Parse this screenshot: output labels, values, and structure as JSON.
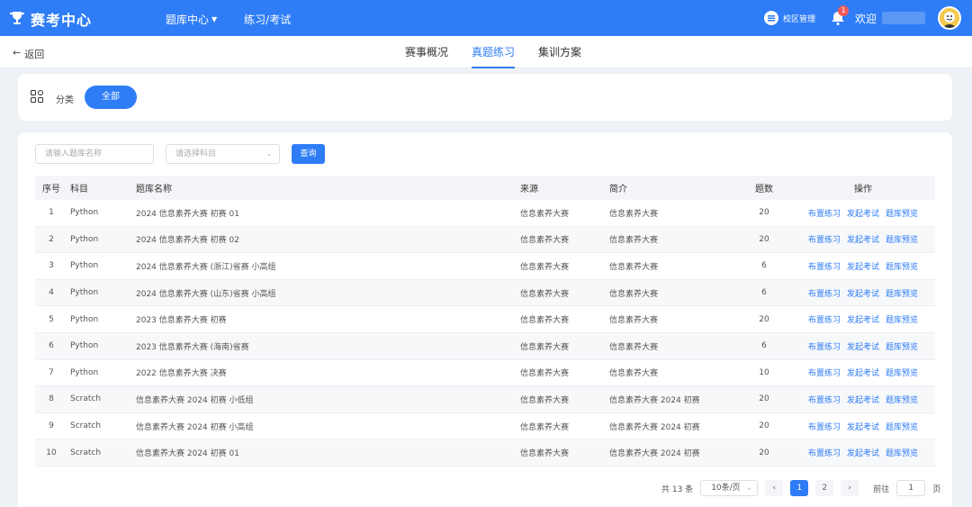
{
  "header": {
    "brand": "赛考中心",
    "nav": [
      {
        "label": "题库中心",
        "has_dropdown": true
      },
      {
        "label": "练习/考试",
        "has_dropdown": false
      }
    ],
    "campus_label": "校区管理",
    "notification_count": "1",
    "welcome": "欢迎"
  },
  "subnav": {
    "back_label": "返回",
    "tabs": [
      {
        "label": "赛事概况",
        "active": false
      },
      {
        "label": "真题练习",
        "active": true
      },
      {
        "label": "集训方案",
        "active": false
      }
    ]
  },
  "category": {
    "label": "分类",
    "selected": "全部"
  },
  "filters": {
    "search_placeholder": "请输入题库名称",
    "subject_placeholder": "请选择科目",
    "query_label": "查询"
  },
  "table": {
    "headers": {
      "index": "序号",
      "subject": "科目",
      "name": "题库名称",
      "source": "来源",
      "desc": "简介",
      "count": "题数",
      "ops": "操作"
    },
    "ops_labels": {
      "assign": "布置练习",
      "exam": "发起考试",
      "preview": "题库预览"
    },
    "rows": [
      {
        "index": "1",
        "subject": "Python",
        "name": "2024 信息素养大赛 初赛 01",
        "source": "信息素养大赛",
        "desc": "信息素养大赛",
        "count": "20"
      },
      {
        "index": "2",
        "subject": "Python",
        "name": "2024 信息素养大赛 初赛 02",
        "source": "信息素养大赛",
        "desc": "信息素养大赛",
        "count": "20"
      },
      {
        "index": "3",
        "subject": "Python",
        "name": "2024 信息素养大赛 (浙江)省赛 小高组",
        "source": "信息素养大赛",
        "desc": "信息素养大赛",
        "count": "6"
      },
      {
        "index": "4",
        "subject": "Python",
        "name": "2024 信息素养大赛 (山东)省赛 小高组",
        "source": "信息素养大赛",
        "desc": "信息素养大赛",
        "count": "6"
      },
      {
        "index": "5",
        "subject": "Python",
        "name": "2023 信息素养大赛 初赛",
        "source": "信息素养大赛",
        "desc": "信息素养大赛",
        "count": "20"
      },
      {
        "index": "6",
        "subject": "Python",
        "name": "2023 信息素养大赛 (海南)省赛",
        "source": "信息素养大赛",
        "desc": "信息素养大赛",
        "count": "6"
      },
      {
        "index": "7",
        "subject": "Python",
        "name": "2022 信息素养大赛 决赛",
        "source": "信息素养大赛",
        "desc": "信息素养大赛",
        "count": "10"
      },
      {
        "index": "8",
        "subject": "Scratch",
        "name": "信息素养大赛 2024 初赛 小低组",
        "source": "信息素养大赛",
        "desc": "信息素养大赛 2024 初赛",
        "count": "20"
      },
      {
        "index": "9",
        "subject": "Scratch",
        "name": "信息素养大赛 2024 初赛 小高组",
        "source": "信息素养大赛",
        "desc": "信息素养大赛 2024 初赛",
        "count": "20"
      },
      {
        "index": "10",
        "subject": "Scratch",
        "name": "信息素养大赛 2024 初赛 01",
        "source": "信息素养大赛",
        "desc": "信息素养大赛 2024 初赛",
        "count": "20"
      }
    ]
  },
  "pagination": {
    "total_text": "共 13 条",
    "page_size": "10条/页",
    "pages": [
      "1",
      "2"
    ],
    "current_page": "1",
    "goto_prefix": "前往",
    "goto_value": "1",
    "goto_suffix": "页"
  },
  "colors": {
    "primary": "#2f7df6",
    "background": "#eef1f5"
  }
}
